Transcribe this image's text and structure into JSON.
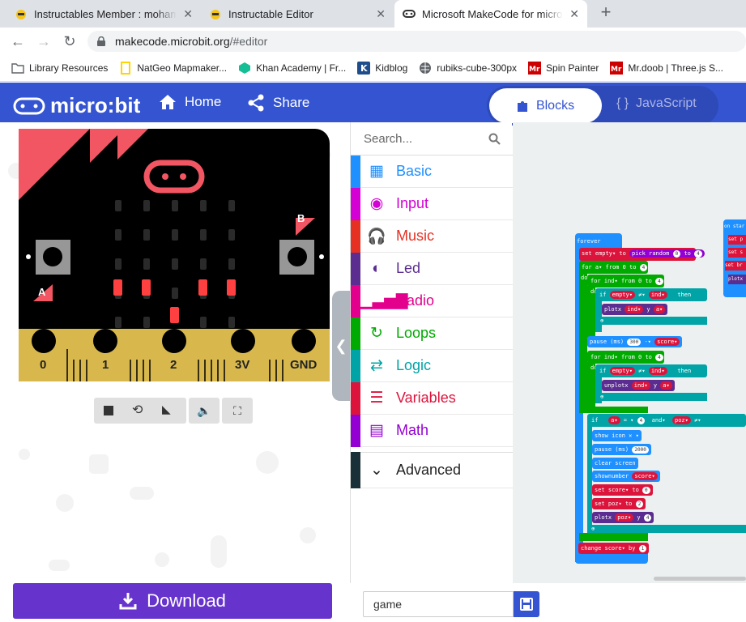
{
  "tabs": [
    {
      "title": "Instructables Member : mohammed",
      "active": false
    },
    {
      "title": "Instructable Editor",
      "active": false
    },
    {
      "title": "Microsoft MakeCode for micro:bit",
      "active": true
    }
  ],
  "address": {
    "domain": "makecode.microbit.org",
    "path": "/#editor"
  },
  "bookmarks": [
    "Library Resources",
    "NatGeo Mapmaker...",
    "Khan Academy | Fr...",
    "Kidblog",
    "rubiks-cube-300px",
    "Spin Painter",
    "Mr.doob | Three.js S..."
  ],
  "header": {
    "brand": "micro:bit",
    "home": "Home",
    "share": "Share",
    "blocks": "Blocks",
    "javascript": "JavaScript"
  },
  "board": {
    "pins": [
      "0",
      "1",
      "2",
      "3V",
      "GND"
    ],
    "button_a": "A",
    "button_b": "B"
  },
  "toolbox": {
    "search_placeholder": "Search...",
    "categories": [
      {
        "label": "Basic",
        "color": "#1e90ff"
      },
      {
        "label": "Input",
        "color": "#d400d4"
      },
      {
        "label": "Music",
        "color": "#e63022"
      },
      {
        "label": "Led",
        "color": "#5c2d91"
      },
      {
        "label": "Radio",
        "color": "#e3008c"
      },
      {
        "label": "Loops",
        "color": "#00aa00"
      },
      {
        "label": "Logic",
        "color": "#00a4a6"
      },
      {
        "label": "Variables",
        "color": "#dc143c"
      },
      {
        "label": "Math",
        "color": "#9400d3"
      }
    ],
    "advanced": "Advanced"
  },
  "blocks": {
    "forever": "forever",
    "on_start": "on star",
    "set_empty": "set empty",
    "to": "to",
    "pick_random": "pick random",
    "n0": "0",
    "n4": "4",
    "n300": "300",
    "n2000": "2000",
    "n1": "1",
    "n2": "2",
    "for_a": "for  a",
    "for_ind": "for  ind",
    "from": "from 0 to",
    "do": "do",
    "if": "if",
    "then": "then",
    "empty": "empty",
    "ind": "ind",
    "ne": "≠",
    "plotx": "plotx",
    "unplotx": "unplotx",
    "y": "y",
    "a": "a",
    "pause": "pause (ms)",
    "minus": "-",
    "score": "score",
    "and": "and",
    "poz": "poz",
    "show_icon": "show icon",
    "clear_screen": "clear screen",
    "show_number": "shownumber",
    "set_score": "set score",
    "set_poz": "set poz",
    "plotx_poz": "plotx",
    "change_score": "change score",
    "by": "by",
    "set_p": "set p",
    "set_s": "set s",
    "set_br": "set br",
    "plotx2": "plotx"
  },
  "footer": {
    "download": "Download",
    "project_name": "game"
  }
}
